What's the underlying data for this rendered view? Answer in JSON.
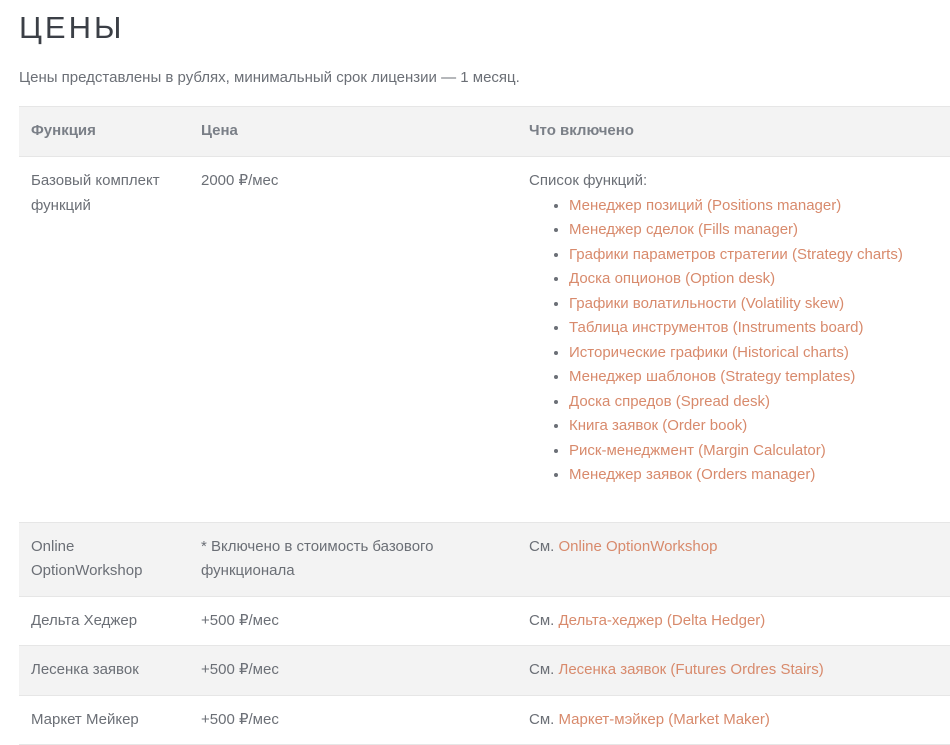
{
  "page": {
    "title": "ЦЕНЫ",
    "intro": "Цены представлены в рублях, минимальный срок лицензии — 1 месяц."
  },
  "table": {
    "headers": {
      "feature": "Функция",
      "price": "Цена",
      "included": "Что включено"
    },
    "base": {
      "feature": "Базовый комплект функций",
      "price": "2000 ₽/мес",
      "list_label": "Список функций:",
      "items": [
        "Менеджер позиций (Positions manager)",
        "Менеджер сделок (Fills manager)",
        "Графики параметров стратегии (Strategy charts)",
        "Доска опционов (Option desk)",
        "Графики волатильности (Volatility skew)",
        "Таблица инструментов (Instruments board)",
        "Исторические графики (Historical charts)",
        "Менеджер шаблонов (Strategy templates)",
        "Доска спредов (Spread desk)",
        "Книга заявок (Order book)",
        "Риск-менеджмент (Margin Calculator)",
        "Менеджер заявок (Orders manager)"
      ]
    },
    "see_prefix": "См.",
    "rows": [
      {
        "feature": "Online OptionWorkshop",
        "price": "* Включено в стоимость базового функционала",
        "link": "Online OptionWorkshop"
      },
      {
        "feature": "Дельта Хеджер",
        "price": "+500 ₽/мес",
        "link": "Дельта-хеджер (Delta Hedger)"
      },
      {
        "feature": "Лесенка заявок",
        "price": "+500 ₽/мес",
        "link": "Лесенка заявок (Futures Ordres Stairs)"
      },
      {
        "feature": "Маркет Мейкер",
        "price": "+500 ₽/мес",
        "link": "Маркет-мэйкер (Market Maker)"
      }
    ]
  },
  "colors": {
    "link": "#d88a6c",
    "text": "#6b6f76",
    "title": "#3b3f46",
    "stripe": "#f3f3f3"
  }
}
